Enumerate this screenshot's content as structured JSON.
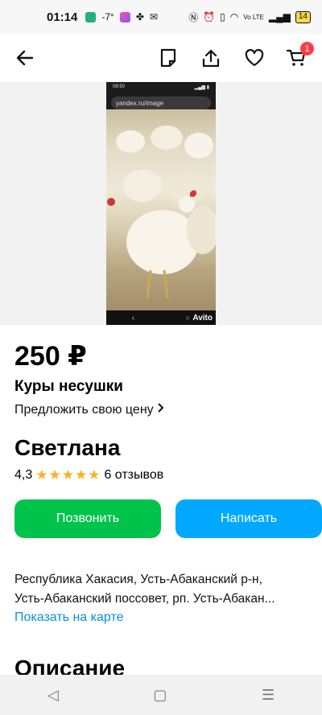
{
  "status_bar": {
    "time": "01:14",
    "temp": "-7°",
    "battery": "14",
    "net_label": "Vo LTE"
  },
  "app_bar": {
    "cart_count": "1"
  },
  "photo": {
    "mini_time": "08:50",
    "mini_url": "yandex.ru/image",
    "watermark": "Avito"
  },
  "listing": {
    "price": "250 ₽",
    "title": "Куры несушки",
    "offer_label": "Предложить свою цену",
    "seller_name": "Светлана",
    "rating": "4,3",
    "stars": "★★★★★",
    "reviews": "6 отзывов",
    "call_label": "Позвонить",
    "write_label": "Написать",
    "address_line1": "Республика Хакасия, Усть-Абаканский р-н,",
    "address_line2": "Усть-Абаканский поссовет, рп. Усть-Абакан...",
    "map_link": "Показать на карте",
    "description_heading": "Описание"
  },
  "nav": {
    "back": "◁",
    "home": "▢",
    "menu": "☰"
  },
  "colors": {
    "call_green": "#00c34b",
    "write_blue": "#00a8ff",
    "star_yellow": "#ffb021",
    "link_blue": "#0a8fe0",
    "badge_red": "#ff3b4a"
  }
}
